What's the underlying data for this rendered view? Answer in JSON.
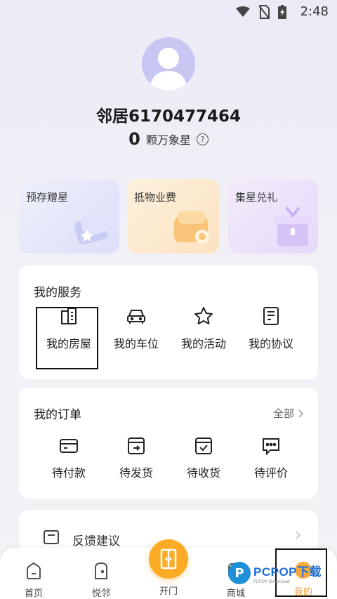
{
  "status_bar": {
    "time": "2:48",
    "icons": [
      "wifi-icon",
      "no-sim-icon",
      "battery-icon"
    ]
  },
  "profile": {
    "username": "邻居6170477464",
    "stars_count": "0",
    "stars_label": "颗万象星",
    "help_icon": "question-circle-icon"
  },
  "promos": [
    {
      "title": "预存赠星",
      "art": "wallet-star-icon",
      "color": "#d8dbf7"
    },
    {
      "title": "抵物业费",
      "art": "wallet-coins-icon",
      "color": "#fbd8a8"
    },
    {
      "title": "集星兑礼",
      "art": "gift-box-icon",
      "color": "#e2d2f8"
    }
  ],
  "services": {
    "title": "我的服务",
    "items": [
      {
        "label": "我的房屋",
        "icon": "building-icon"
      },
      {
        "label": "我的车位",
        "icon": "car-icon"
      },
      {
        "label": "我的活动",
        "icon": "star-icon"
      },
      {
        "label": "我的协议",
        "icon": "document-icon"
      }
    ]
  },
  "orders": {
    "title": "我的订单",
    "more_label": "全部",
    "items": [
      {
        "label": "待付款",
        "icon": "card-icon"
      },
      {
        "label": "待发货",
        "icon": "box-arrow-icon"
      },
      {
        "label": "待收货",
        "icon": "box-check-icon"
      },
      {
        "label": "待评价",
        "icon": "chat-dots-icon"
      }
    ]
  },
  "feedback": {
    "label": "反馈建议",
    "icon": "feedback-icon"
  },
  "tabbar": {
    "home": "首页",
    "neighbor": "悦邻",
    "door": "开门",
    "mall": "商城",
    "mine": "我的"
  },
  "watermark": {
    "brand": "PCPOP下载",
    "sub": "PCPOP Download"
  },
  "colors": {
    "accent": "#fbab25",
    "avatar_bg": "#c8c6f3"
  }
}
